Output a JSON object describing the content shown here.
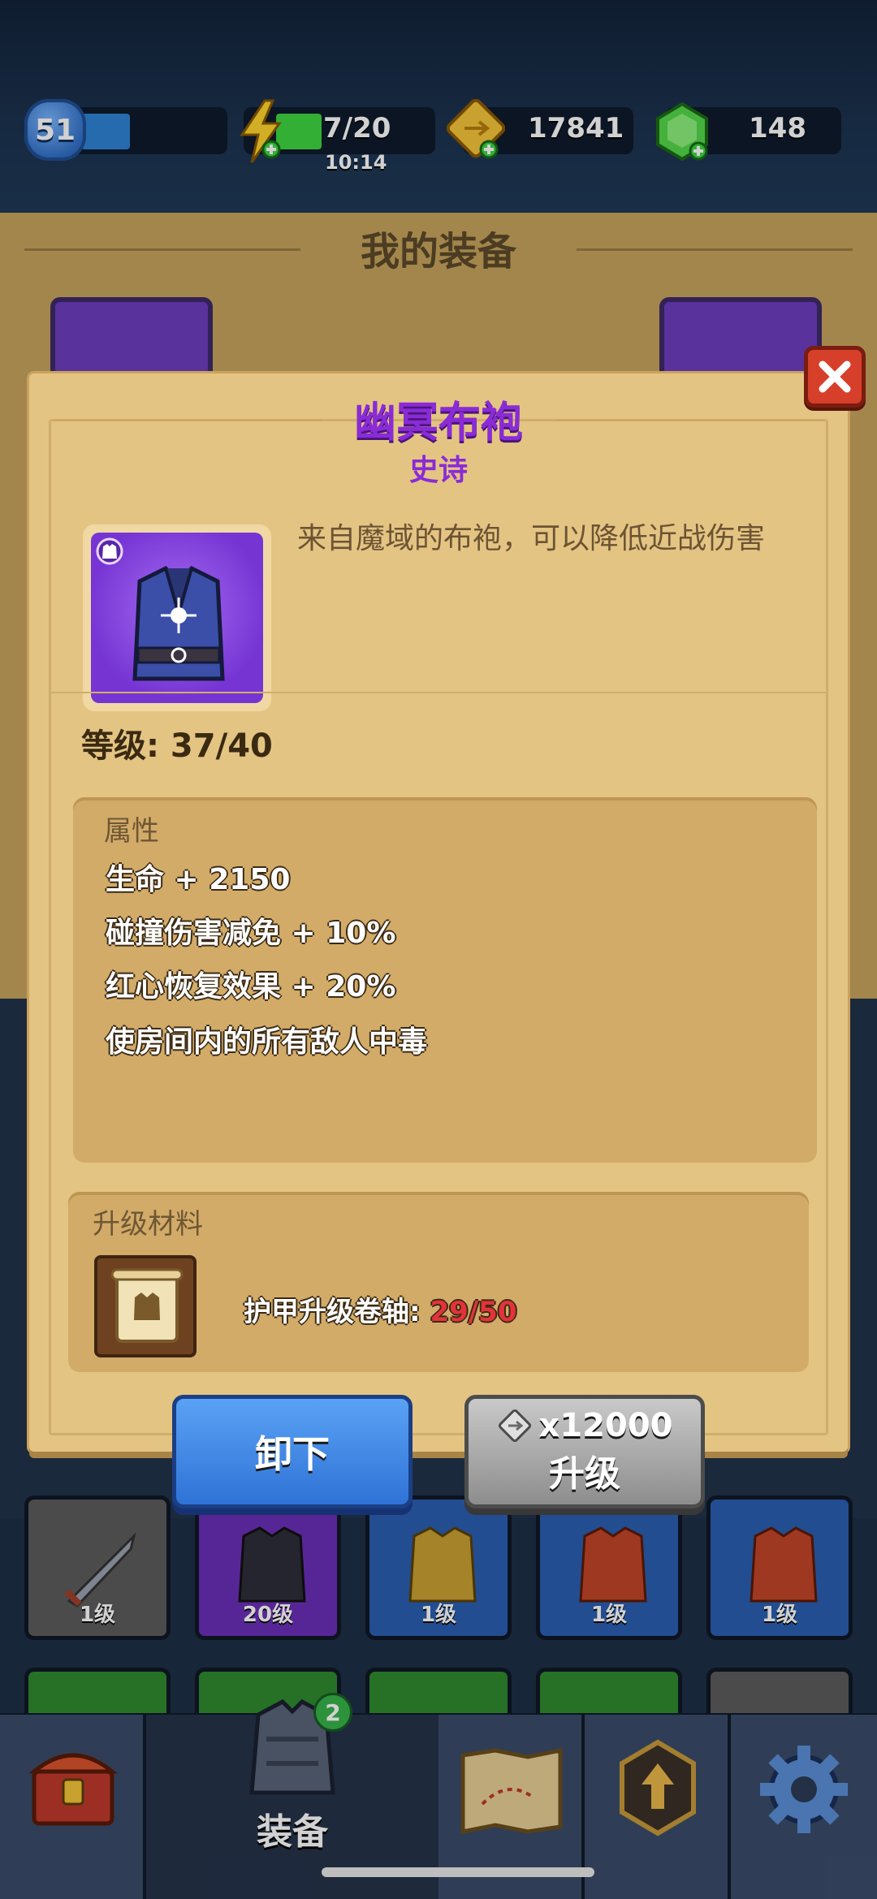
{
  "hud": {
    "level": "51",
    "energy": "7/20",
    "energy_timer": "10:14",
    "gold": "17841",
    "gems": "148"
  },
  "page": {
    "title": "我的装备"
  },
  "grid": {
    "cards": [
      {
        "level": "1级",
        "color": "#5c5c5c",
        "icon": "sword-icon"
      },
      {
        "level": "20级",
        "color": "#6b2fb8",
        "icon": "dark-armor-icon"
      },
      {
        "level": "1级",
        "color": "#2a5fb0",
        "icon": "gold-armor-icon"
      },
      {
        "level": "1级",
        "color": "#2a5fb0",
        "icon": "red-armor-icon"
      },
      {
        "level": "1级",
        "color": "#2a5fb0",
        "icon": "red-armor-icon"
      }
    ]
  },
  "modal": {
    "name": "幽冥布袍",
    "rarity": "史诗",
    "description": "来自魔域的布袍，可以降低近战伤害",
    "level_label": "等级: 37/40",
    "attributes_title": "属性",
    "attributes": [
      "生命 + 2150",
      "碰撞伤害减免 + 10%",
      "红心恢复效果 + 20%",
      "使房间内的所有敌人中毒"
    ],
    "materials_title": "升级材料",
    "material_name": "护甲升级卷轴: ",
    "material_count": "29/50",
    "unequip_label": "卸下",
    "upgrade_cost": "x12000",
    "upgrade_label": "升级"
  },
  "nav": {
    "equipment_label": "装备",
    "equipment_badge": "2"
  },
  "colors": {
    "epic": "#8a2bd6",
    "modal_bg": "#e4c483",
    "unequip_blue": "#2f73d6",
    "upgrade_gray": "#8d8d8d",
    "material_red": "#e3333a"
  }
}
